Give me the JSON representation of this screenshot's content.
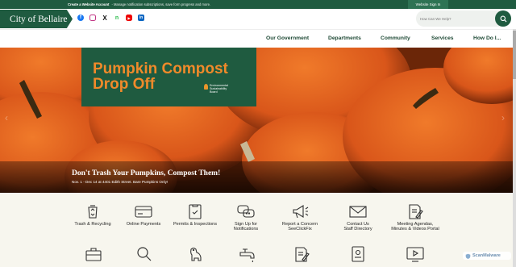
{
  "topbar": {
    "create_title": "Create a Website Account",
    "create_desc": "- Manage notification subscriptions, save form progress and more.",
    "signin_label": "Website Sign In"
  },
  "header": {
    "logo": "City of Bellaire",
    "social": [
      "facebook-icon",
      "instagram-icon",
      "x-icon",
      "nextdoor-icon",
      "youtube-icon",
      "linkedin-icon"
    ],
    "search_placeholder": "How Can We Help?"
  },
  "nav": {
    "items": [
      "Our Government",
      "Departments",
      "Community",
      "Services",
      "How Do I..."
    ]
  },
  "hero": {
    "promo_line1": "Pumpkin Compost",
    "promo_line2": "Drop Off",
    "board": "Environmental Sustainability Board",
    "caption_title": "Don't Trash Your Pumpkins, Compost Them!",
    "caption_sub": "Nov. 1 - Dec 14 at 4401 Edith Street. Bare Pumpkins Only!"
  },
  "quicklinks": {
    "row1": [
      {
        "label1": "Trash & Recycling",
        "label2": "",
        "icon": "trash-recycling-icon"
      },
      {
        "label1": "Online Payments",
        "label2": "",
        "icon": "credit-card-icon"
      },
      {
        "label1": "Permits & Inspections",
        "label2": "",
        "icon": "clipboard-check-icon"
      },
      {
        "label1": "Sign Up for",
        "label2": "Notifications",
        "icon": "chat-bubbles-icon"
      },
      {
        "label1": "Report a Concern",
        "label2": "SeeClickFix",
        "icon": "megaphone-icon"
      },
      {
        "label1": "Contact Us",
        "label2": "Staff Directory",
        "icon": "envelope-icon"
      },
      {
        "label1": "Meeting Agendas,",
        "label2": "Minutes & Videos Portal",
        "icon": "document-pen-icon"
      }
    ],
    "row2": [
      "briefcase-icon",
      "magnifier-icon",
      "dog-icon",
      "faucet-icon",
      "document-pen-icon",
      "id-card-icon",
      "video-screen-icon"
    ]
  },
  "badge": "ScanMalware",
  "colors": {
    "brand_green": "#1f5b40",
    "promo_orange": "#f08a2a",
    "nav_text": "#1f4a36"
  }
}
